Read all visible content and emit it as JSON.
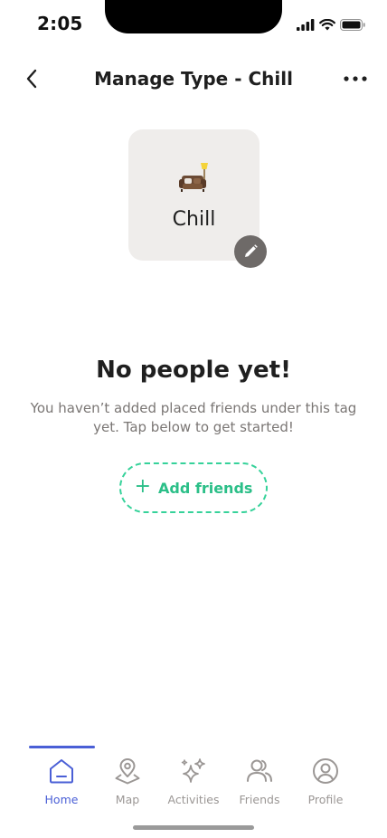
{
  "status_bar": {
    "time": "2:05"
  },
  "nav": {
    "title": "Manage Type - Chill"
  },
  "type_card": {
    "label": "Chill",
    "icon": "couch-lamp-icon"
  },
  "empty_state": {
    "title": "No people yet!",
    "description": "You haven’t added placed friends under this tag yet. Tap below to get started!",
    "button_label": "Add friends"
  },
  "tabs": [
    {
      "label": "Home",
      "icon": "home-icon",
      "active": true
    },
    {
      "label": "Map",
      "icon": "map-pin-icon",
      "active": false
    },
    {
      "label": "Activities",
      "icon": "sparkles-icon",
      "active": false
    },
    {
      "label": "Friends",
      "icon": "friends-icon",
      "active": false
    },
    {
      "label": "Profile",
      "icon": "profile-icon",
      "active": false
    }
  ],
  "colors": {
    "accent": "#4a5fd6",
    "add_button": "#2bbf88",
    "card_bg": "#efedeb",
    "edit_button": "#6e6a68",
    "muted_text": "#9b9795"
  }
}
